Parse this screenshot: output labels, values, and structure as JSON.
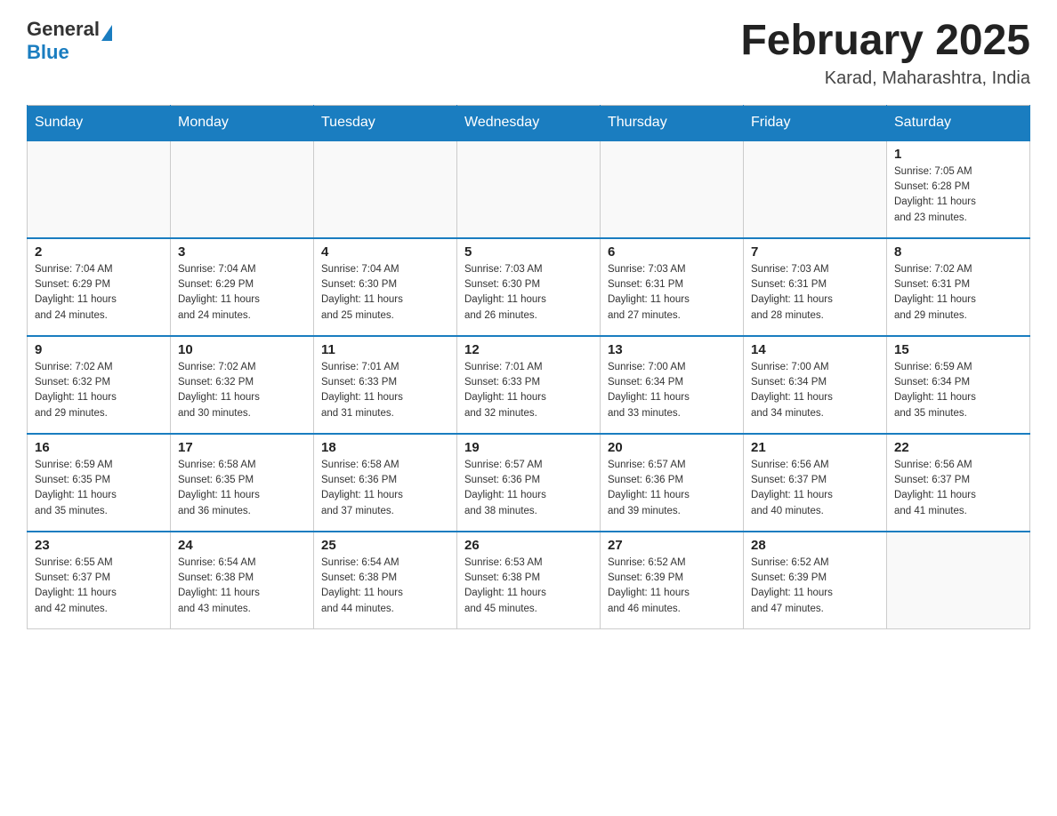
{
  "header": {
    "logo_general": "General",
    "logo_blue": "Blue",
    "month_title": "February 2025",
    "location": "Karad, Maharashtra, India"
  },
  "days_of_week": [
    "Sunday",
    "Monday",
    "Tuesday",
    "Wednesday",
    "Thursday",
    "Friday",
    "Saturday"
  ],
  "weeks": [
    [
      {
        "day": "",
        "info": ""
      },
      {
        "day": "",
        "info": ""
      },
      {
        "day": "",
        "info": ""
      },
      {
        "day": "",
        "info": ""
      },
      {
        "day": "",
        "info": ""
      },
      {
        "day": "",
        "info": ""
      },
      {
        "day": "1",
        "info": "Sunrise: 7:05 AM\nSunset: 6:28 PM\nDaylight: 11 hours\nand 23 minutes."
      }
    ],
    [
      {
        "day": "2",
        "info": "Sunrise: 7:04 AM\nSunset: 6:29 PM\nDaylight: 11 hours\nand 24 minutes."
      },
      {
        "day": "3",
        "info": "Sunrise: 7:04 AM\nSunset: 6:29 PM\nDaylight: 11 hours\nand 24 minutes."
      },
      {
        "day": "4",
        "info": "Sunrise: 7:04 AM\nSunset: 6:30 PM\nDaylight: 11 hours\nand 25 minutes."
      },
      {
        "day": "5",
        "info": "Sunrise: 7:03 AM\nSunset: 6:30 PM\nDaylight: 11 hours\nand 26 minutes."
      },
      {
        "day": "6",
        "info": "Sunrise: 7:03 AM\nSunset: 6:31 PM\nDaylight: 11 hours\nand 27 minutes."
      },
      {
        "day": "7",
        "info": "Sunrise: 7:03 AM\nSunset: 6:31 PM\nDaylight: 11 hours\nand 28 minutes."
      },
      {
        "day": "8",
        "info": "Sunrise: 7:02 AM\nSunset: 6:31 PM\nDaylight: 11 hours\nand 29 minutes."
      }
    ],
    [
      {
        "day": "9",
        "info": "Sunrise: 7:02 AM\nSunset: 6:32 PM\nDaylight: 11 hours\nand 29 minutes."
      },
      {
        "day": "10",
        "info": "Sunrise: 7:02 AM\nSunset: 6:32 PM\nDaylight: 11 hours\nand 30 minutes."
      },
      {
        "day": "11",
        "info": "Sunrise: 7:01 AM\nSunset: 6:33 PM\nDaylight: 11 hours\nand 31 minutes."
      },
      {
        "day": "12",
        "info": "Sunrise: 7:01 AM\nSunset: 6:33 PM\nDaylight: 11 hours\nand 32 minutes."
      },
      {
        "day": "13",
        "info": "Sunrise: 7:00 AM\nSunset: 6:34 PM\nDaylight: 11 hours\nand 33 minutes."
      },
      {
        "day": "14",
        "info": "Sunrise: 7:00 AM\nSunset: 6:34 PM\nDaylight: 11 hours\nand 34 minutes."
      },
      {
        "day": "15",
        "info": "Sunrise: 6:59 AM\nSunset: 6:34 PM\nDaylight: 11 hours\nand 35 minutes."
      }
    ],
    [
      {
        "day": "16",
        "info": "Sunrise: 6:59 AM\nSunset: 6:35 PM\nDaylight: 11 hours\nand 35 minutes."
      },
      {
        "day": "17",
        "info": "Sunrise: 6:58 AM\nSunset: 6:35 PM\nDaylight: 11 hours\nand 36 minutes."
      },
      {
        "day": "18",
        "info": "Sunrise: 6:58 AM\nSunset: 6:36 PM\nDaylight: 11 hours\nand 37 minutes."
      },
      {
        "day": "19",
        "info": "Sunrise: 6:57 AM\nSunset: 6:36 PM\nDaylight: 11 hours\nand 38 minutes."
      },
      {
        "day": "20",
        "info": "Sunrise: 6:57 AM\nSunset: 6:36 PM\nDaylight: 11 hours\nand 39 minutes."
      },
      {
        "day": "21",
        "info": "Sunrise: 6:56 AM\nSunset: 6:37 PM\nDaylight: 11 hours\nand 40 minutes."
      },
      {
        "day": "22",
        "info": "Sunrise: 6:56 AM\nSunset: 6:37 PM\nDaylight: 11 hours\nand 41 minutes."
      }
    ],
    [
      {
        "day": "23",
        "info": "Sunrise: 6:55 AM\nSunset: 6:37 PM\nDaylight: 11 hours\nand 42 minutes."
      },
      {
        "day": "24",
        "info": "Sunrise: 6:54 AM\nSunset: 6:38 PM\nDaylight: 11 hours\nand 43 minutes."
      },
      {
        "day": "25",
        "info": "Sunrise: 6:54 AM\nSunset: 6:38 PM\nDaylight: 11 hours\nand 44 minutes."
      },
      {
        "day": "26",
        "info": "Sunrise: 6:53 AM\nSunset: 6:38 PM\nDaylight: 11 hours\nand 45 minutes."
      },
      {
        "day": "27",
        "info": "Sunrise: 6:52 AM\nSunset: 6:39 PM\nDaylight: 11 hours\nand 46 minutes."
      },
      {
        "day": "28",
        "info": "Sunrise: 6:52 AM\nSunset: 6:39 PM\nDaylight: 11 hours\nand 47 minutes."
      },
      {
        "day": "",
        "info": ""
      }
    ]
  ]
}
